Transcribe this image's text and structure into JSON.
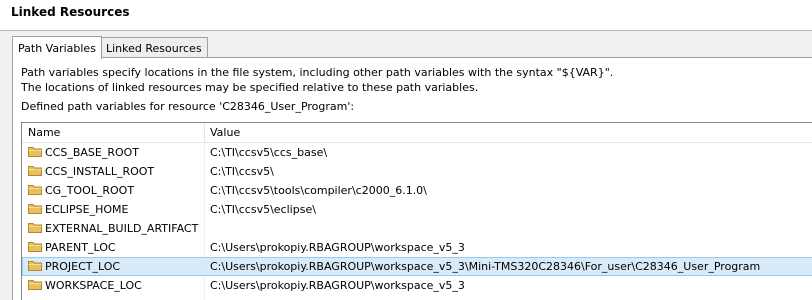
{
  "header": {
    "title": "Linked Resources"
  },
  "tabs": [
    {
      "label": "Path Variables",
      "active": true
    },
    {
      "label": "Linked Resources",
      "active": false
    }
  ],
  "description": {
    "line1": "Path variables specify locations in the file system, including other path variables with the syntax \"${VAR}\".",
    "line2": "The locations of linked resources may be specified relative to these path variables.",
    "line3": "Defined path variables for resource 'C28346_User_Program':"
  },
  "table": {
    "columns": {
      "name": "Name",
      "value": "Value"
    },
    "rows": [
      {
        "name": "CCS_BASE_ROOT",
        "value": "C:\\TI\\ccsv5\\ccs_base\\"
      },
      {
        "name": "CCS_INSTALL_ROOT",
        "value": "C:\\TI\\ccsv5\\"
      },
      {
        "name": "CG_TOOL_ROOT",
        "value": "C:\\TI\\ccsv5\\tools\\compiler\\c2000_6.1.0\\"
      },
      {
        "name": "ECLIPSE_HOME",
        "value": "C:\\TI\\ccsv5\\eclipse\\"
      },
      {
        "name": "EXTERNAL_BUILD_ARTIFACT",
        "value": ""
      },
      {
        "name": "PARENT_LOC",
        "value": "C:\\Users\\prokopiy.RBAGROUP\\workspace_v5_3"
      },
      {
        "name": "PROJECT_LOC",
        "value": "C:\\Users\\prokopiy.RBAGROUP\\workspace_v5_3\\Mini-TMS320C28346\\For_user\\C28346_User_Program",
        "selected": true
      },
      {
        "name": "WORKSPACE_LOC",
        "value": "C:\\Users\\prokopiy.RBAGROUP\\workspace_v5_3"
      }
    ]
  },
  "colors": {
    "selection_bg": "#d9ebf9",
    "selection_border": "#99c9ef",
    "folder": "#e8c060"
  }
}
